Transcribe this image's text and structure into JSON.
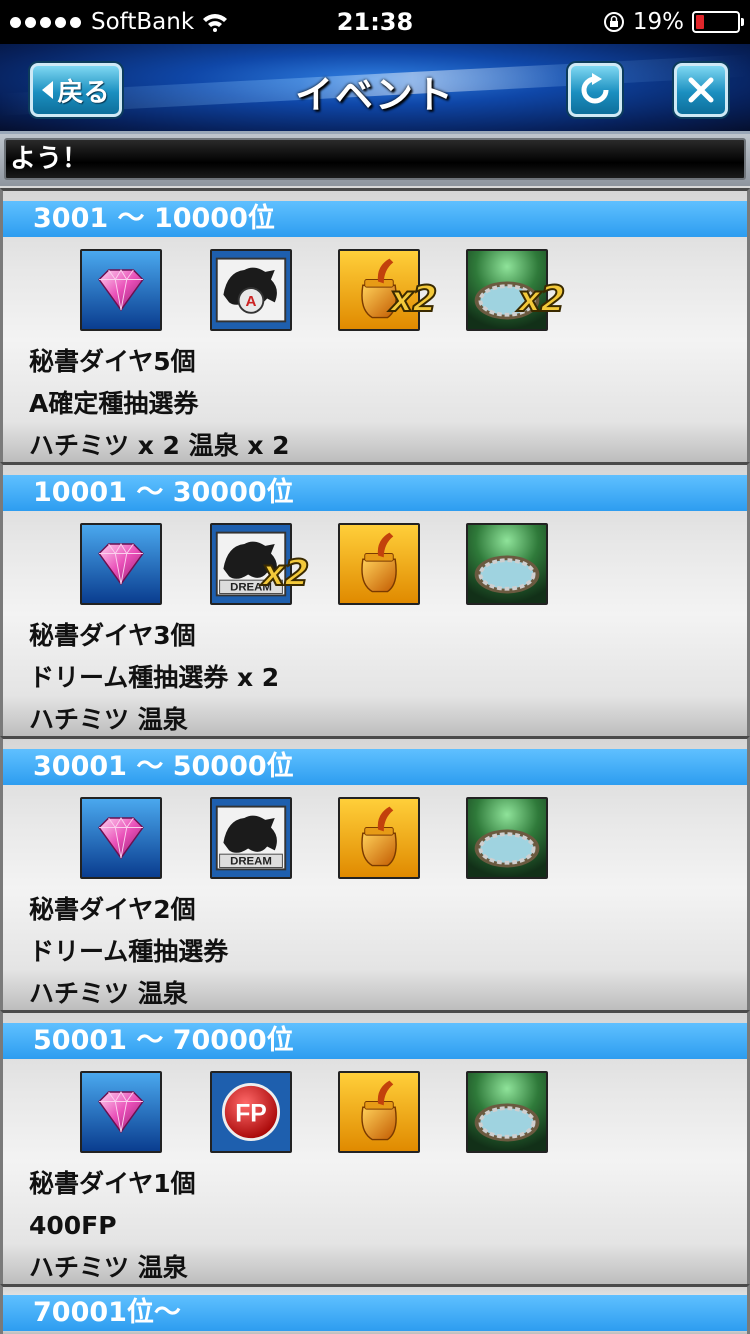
{
  "status": {
    "carrier": "SoftBank",
    "time": "21:38",
    "battery": "19%",
    "battery_level": 0.19
  },
  "header": {
    "title": "イベント",
    "back_label": "戻る"
  },
  "ticker": {
    "text": "よう！"
  },
  "sections": [
    {
      "rank": "3001 〜 10000位",
      "icons": [
        {
          "type": "diamond-icon"
        },
        {
          "type": "ticket-a-icon"
        },
        {
          "type": "honey-icon",
          "mult": "x2"
        },
        {
          "type": "hot-spring-icon",
          "mult": "x2"
        }
      ],
      "lines": [
        "秘書ダイヤ5個",
        "A確定種抽選券",
        "ハチミツ x 2  温泉 x 2"
      ]
    },
    {
      "rank": "10001 〜 30000位",
      "icons": [
        {
          "type": "diamond-icon"
        },
        {
          "type": "ticket-dream-icon",
          "mult": "x2"
        },
        {
          "type": "honey-icon"
        },
        {
          "type": "hot-spring-icon"
        }
      ],
      "lines": [
        "秘書ダイヤ3個",
        "ドリーム種抽選券 x 2",
        "ハチミツ  温泉"
      ]
    },
    {
      "rank": "30001 〜 50000位",
      "icons": [
        {
          "type": "diamond-icon"
        },
        {
          "type": "ticket-dream-icon"
        },
        {
          "type": "honey-icon"
        },
        {
          "type": "hot-spring-icon"
        }
      ],
      "lines": [
        "秘書ダイヤ2個",
        "ドリーム種抽選券",
        "ハチミツ  温泉"
      ]
    },
    {
      "rank": "50001 〜 70000位",
      "icons": [
        {
          "type": "diamond-icon"
        },
        {
          "type": "fp-icon"
        },
        {
          "type": "honey-icon"
        },
        {
          "type": "hot-spring-icon"
        }
      ],
      "lines": [
        "秘書ダイヤ1個",
        "400FP",
        "ハチミツ  温泉"
      ]
    }
  ],
  "last_rank": "70001位〜",
  "icon_labels": {
    "dream": "DREAM",
    "fp": "FP",
    "a": "A"
  }
}
